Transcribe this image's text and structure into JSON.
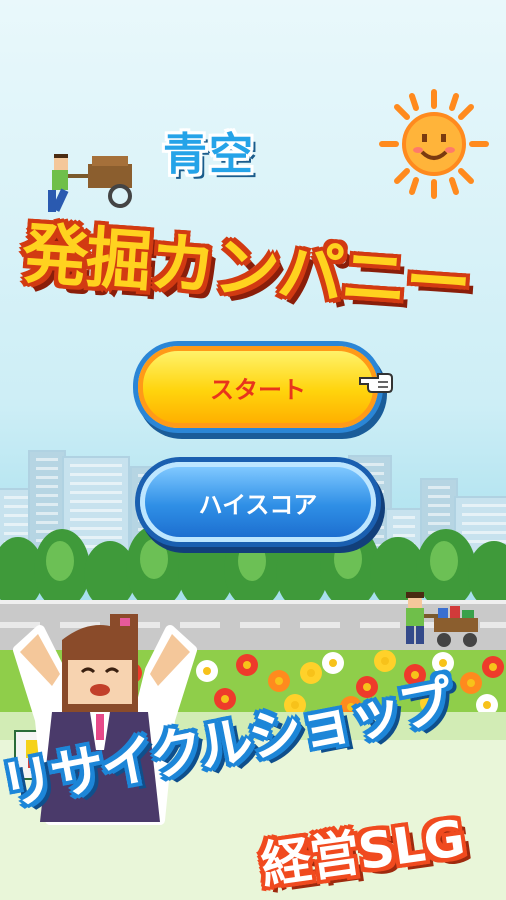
{
  "title": {
    "line1": "青空",
    "line2": "発掘カンパニー"
  },
  "menu": {
    "start_label": "スタート",
    "highscore_label": "ハイスコア"
  },
  "banner": {
    "line1": "リサイクルショップ",
    "line2": "経営SLG"
  },
  "colors": {
    "sky": "#cdeef6",
    "start_button": "#ffd40d",
    "highscore_button": "#2f8fe6",
    "title_yellow": "#ffd21f",
    "title_blue": "#25a3e8",
    "banner_blue": "#1d86d8",
    "banner_orange": "#f04a1f"
  },
  "icons": [
    "sun-icon",
    "pointing-hand-icon",
    "worker-with-cart",
    "girl-character",
    "flowerbed"
  ]
}
